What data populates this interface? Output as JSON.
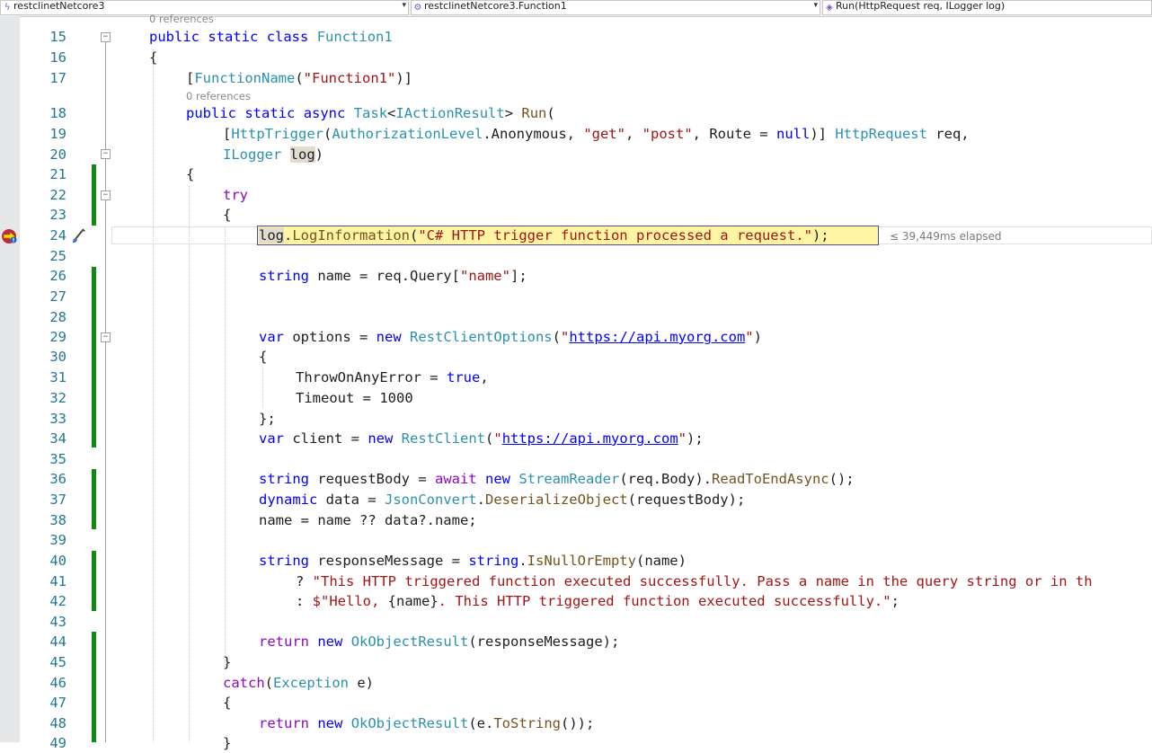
{
  "nav": {
    "project": "restclinetNetcore3",
    "type": "restclinetNetcore3.Function1",
    "member": "Run(HttpRequest req, ILogger log)"
  },
  "codelens": [
    "0 references",
    "0 references"
  ],
  "elapsed": "≤ 39,449ms elapsed",
  "line_numbers": [
    "15",
    "16",
    "17",
    "18",
    "19",
    "20",
    "21",
    "22",
    "23",
    "24",
    "25",
    "26",
    "27",
    "28",
    "29",
    "30",
    "31",
    "32",
    "33",
    "34",
    "35",
    "36",
    "37",
    "38",
    "39",
    "40",
    "41",
    "42",
    "43",
    "44",
    "45",
    "46",
    "47",
    "48",
    "49"
  ],
  "code": {
    "l15": {
      "kw1": "public",
      "kw2": "static",
      "kw3": "class",
      "ty1": "Function1"
    },
    "l16": {
      "t1": "{"
    },
    "l17": {
      "t1": "[",
      "ty1": "FunctionName",
      "t2": "(",
      "s1": "\"Function1\"",
      "t3": ")]"
    },
    "l18": {
      "kw1": "public",
      "kw2": "static",
      "kw3": "async",
      "ty1": "Task",
      "t1": "<",
      "ty2": "IActionResult",
      "t2": ">",
      "fn1": "Run",
      "t3": "("
    },
    "l19": {
      "t1": "[",
      "ty1": "HttpTrigger",
      "t2": "(",
      "ty2": "AuthorizationLevel",
      "t3": ".Anonymous, ",
      "s1": "\"get\"",
      "t4": ", ",
      "s2": "\"post\"",
      "t5": ", Route = ",
      "kw1": "null",
      "t6": ")] ",
      "ty3": "HttpRequest",
      "t7": " req,"
    },
    "l20": {
      "ty1": "ILogger",
      "p1": "log",
      "t1": ")"
    },
    "l21": {
      "t1": "{"
    },
    "l22": {
      "c1": "try"
    },
    "l23": {
      "t1": "{"
    },
    "l24": {
      "p1": "log",
      "t1": ".",
      "fn1": "LogInformation",
      "t2": "(",
      "s1": "\"C# HTTP trigger function processed a request.\"",
      "t3": ");"
    },
    "l26": {
      "kw1": "string",
      "t1": " name = req.Query[",
      "s1": "\"name\"",
      "t2": "];"
    },
    "l29": {
      "kw1": "var",
      "t1": " options = ",
      "kw2": "new",
      "ty1": "RestClientOptions",
      "t2": "(",
      "s1": "\"",
      "u1": "https://api.myorg.com",
      "s2": "\"",
      "t3": ")"
    },
    "l30": {
      "t1": "{"
    },
    "l31": {
      "t1": "ThrowOnAnyError = ",
      "kw1": "true",
      "t2": ","
    },
    "l32": {
      "t1": "Timeout = 1000"
    },
    "l33": {
      "t1": "};"
    },
    "l34": {
      "kw1": "var",
      "t1": " client = ",
      "kw2": "new",
      "ty1": "RestClient",
      "t2": "(",
      "s1": "\"",
      "u1": "https://api.myorg.com",
      "s2": "\"",
      "t3": ");"
    },
    "l36": {
      "kw1": "string",
      "t1": " requestBody = ",
      "c1": "await",
      "kw2": "new",
      "ty1": "StreamReader",
      "t2": "(req.Body).",
      "fn1": "ReadToEndAsync",
      "t3": "();"
    },
    "l37": {
      "kw1": "dynamic",
      "t1": " data = ",
      "ty1": "JsonConvert",
      "t2": ".",
      "fn1": "DeserializeObject",
      "t3": "(requestBody);"
    },
    "l38": {
      "t1": "name = name ?? data?.name;"
    },
    "l40": {
      "kw1": "string",
      "t1": " responseMessage = ",
      "kw2": "string",
      "t2": ".",
      "fn1": "IsNullOrEmpty",
      "t3": "(name)"
    },
    "l41": {
      "t1": "? ",
      "s1": "\"This HTTP triggered function executed successfully. Pass a name in the query string or in th"
    },
    "l42": {
      "t1": ": ",
      "s1": "$\"Hello, ",
      "t2": "{name}",
      "s2": ". This HTTP triggered function executed successfully.\"",
      "t3": ";"
    },
    "l44": {
      "c1": "return",
      "kw1": "new",
      "ty1": "OkObjectResult",
      "t1": "(responseMessage);"
    },
    "l45": {
      "t1": "}"
    },
    "l46": {
      "c1": "catch",
      "t1": "(",
      "ty1": "Exception",
      "t2": " e)"
    },
    "l47": {
      "t1": "{"
    },
    "l48": {
      "c1": "return",
      "kw1": "new",
      "ty1": "OkObjectResult",
      "t1": "(e.",
      "fn1": "ToString",
      "t2": "());"
    },
    "l49": {
      "t1": "}"
    }
  }
}
